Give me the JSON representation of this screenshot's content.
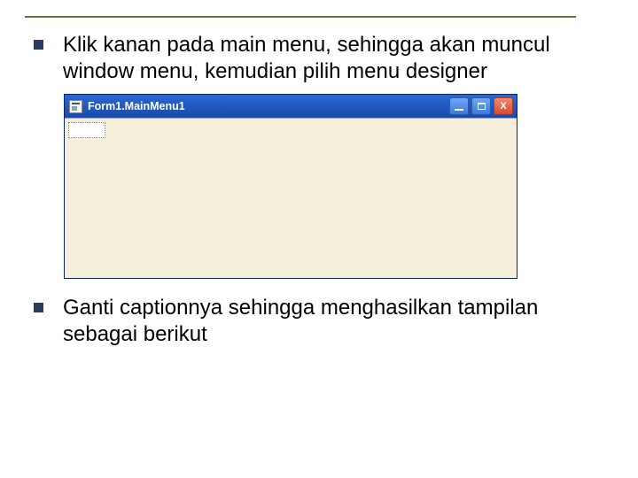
{
  "bullet1": "Klik kanan pada main menu, sehingga akan muncul window menu, kemudian pilih menu designer",
  "bullet2": "Ganti captionnya sehingga menghasilkan tampilan sebagai berikut",
  "window": {
    "title": "Form1.MainMenu1",
    "minimize": "_",
    "maximize": "□",
    "close": "X"
  }
}
